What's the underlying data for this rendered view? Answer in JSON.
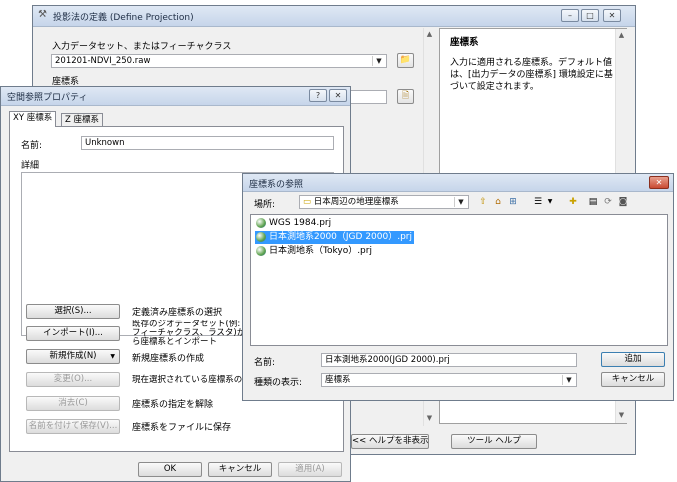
{
  "define_projection": {
    "title": "投影法の定義 (Define Projection)",
    "input_label": "入力データセット、またはフィーチャクラス",
    "input_value": "201201-NDVI_250.raw",
    "cs_label": "座標系",
    "help_title": "座標系",
    "help_text": "入力に適用される座標系。デフォルト値は、[出力データの座標系] 環境設定に基づいて設定されます。",
    "hide_help_button": "<< ヘルプを非表示",
    "tool_help_button": "ツール ヘルプ"
  },
  "spatial_ref": {
    "title": "空間参照プロパティ",
    "help_btn": "?",
    "tabs": [
      "XY 座標系",
      "Z 座標系"
    ],
    "name_label": "名前:",
    "name_value": "Unknown",
    "details_label": "詳細",
    "actions": [
      {
        "button": "選択(S)...",
        "desc": "定義済み座標系の選択"
      },
      {
        "button": "インポート(I)...",
        "desc": "既存のジオデータセット(例: フィーチャクラス、ラスタ)から座標系とインポート"
      },
      {
        "button": "新規作成(N)",
        "desc": "新規座標系の作成"
      },
      {
        "button": "変更(O)...",
        "desc": "現在選択されている座標系のプロパティ"
      },
      {
        "button": "消去(C)",
        "desc": "座標系の指定を解除"
      },
      {
        "button": "名前を付けて保存(V)...",
        "desc": "座標系をファイルに保存"
      }
    ],
    "ok": "OK",
    "cancel": "キャンセル",
    "apply": "適用(A)"
  },
  "browse": {
    "title": "座標系の参照",
    "location_label": "場所:",
    "location_value": "日本周辺の地理座標系",
    "files": [
      "WGS 1984.prj",
      "日本測地系2000（JGD 2000）.prj",
      "日本測地系（Tokyo）.prj"
    ],
    "selected_index": 1,
    "name_label": "名前:",
    "name_value": "日本測地系2000(JGD 2000).prj",
    "type_label": "種類の表示:",
    "type_value": "座標系",
    "add": "追加",
    "cancel": "キャンセル"
  }
}
